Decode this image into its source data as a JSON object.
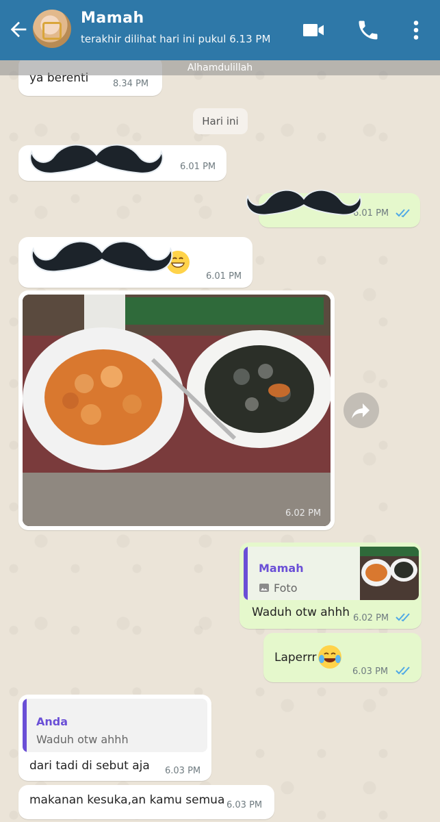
{
  "header": {
    "contact_name": "Mamah",
    "last_seen": "terakhir dilihat hari ini pukul 6.13 PM"
  },
  "sticky_banner": "Alhamdulillah",
  "messages": {
    "m1": {
      "text": "ya berenti",
      "time": "8.34 PM"
    },
    "date_chip": "Hari ini",
    "m2": {
      "time": "6.01 PM"
    },
    "m3": {
      "time": "6.01 PM"
    },
    "m4": {
      "time": "6.01 PM"
    },
    "m5": {
      "time": "6.02 PM"
    },
    "m6": {
      "quote_name": "Mamah",
      "quote_text": "Foto",
      "text": "Waduh otw ahhh",
      "time": "6.02 PM"
    },
    "m7": {
      "text": "Laperrr",
      "time": "6.03 PM"
    },
    "m8": {
      "quote_name": "Anda",
      "quote_text": "Waduh otw ahhh",
      "text": "dari tadi di sebut aja",
      "time": "6.03 PM"
    },
    "m9": {
      "text": "makanan kesuka,an kamu semua",
      "time": "6.03 PM"
    }
  },
  "colors": {
    "header": "#2e78a8",
    "outgoing_bubble": "#e5f8cc",
    "incoming_bubble": "#ffffff",
    "read_ticks": "#4fa8e6",
    "quote_accent": "#6a4fd6"
  },
  "icons": [
    "back-arrow-icon",
    "video-call-icon",
    "phone-icon",
    "more-vert-icon",
    "forward-icon",
    "image-icon",
    "double-check-icon",
    "grinning-emoji-icon",
    "tears-of-joy-emoji-icon"
  ]
}
